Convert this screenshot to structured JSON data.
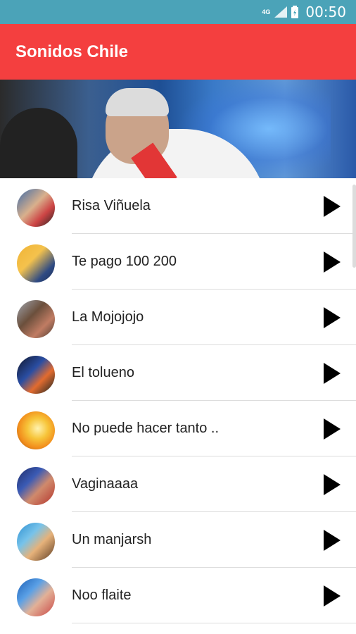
{
  "status": {
    "network": "4G",
    "time": "00:50"
  },
  "app": {
    "title": "Sonidos Chile"
  },
  "sounds": [
    {
      "label": "Risa Viñuela",
      "avatar": "linear-gradient(135deg,#3b6aa8 0%,#d9b08c 45%,#c44 70%,#222 100%)"
    },
    {
      "label": "Te pago 100 200",
      "avatar": "linear-gradient(135deg,#f1b334 0%,#f4c24d 40%,#2e4a83 75%,#1c2d55 100%)"
    },
    {
      "label": "La Mojojojo",
      "avatar": "linear-gradient(135deg,#a0a7b0 0%,#6b4f3c 40%,#c07c63 70%,#4a3b30 100%)"
    },
    {
      "label": "El tolueno",
      "avatar": "linear-gradient(135deg,#101426 0%,#2a4ea3 40%,#e26b2f 65%,#122 100%)"
    },
    {
      "label": "No puede hacer tanto ..",
      "avatar": "radial-gradient(circle at 55% 45%,#fff3b0 0%,#f7c53a 35%,#f28e1c 65%,#8a4a10 100%)"
    },
    {
      "label": "Vaginaaaa",
      "avatar": "linear-gradient(135deg,#1e2b66 0%,#3b5bb5 35%,#d08a6c 60%,#b3332c 100%)"
    },
    {
      "label": "Un manjarsh",
      "avatar": "linear-gradient(135deg,#2e8fd1 0%,#77c3ea 35%,#e6b27a 60%,#5b3a22 100%)"
    },
    {
      "label": "Noo flaite",
      "avatar": "linear-gradient(135deg,#1b5fb5 0%,#5aa0e6 35%,#e2b197 60%,#c94545 100%)"
    }
  ]
}
